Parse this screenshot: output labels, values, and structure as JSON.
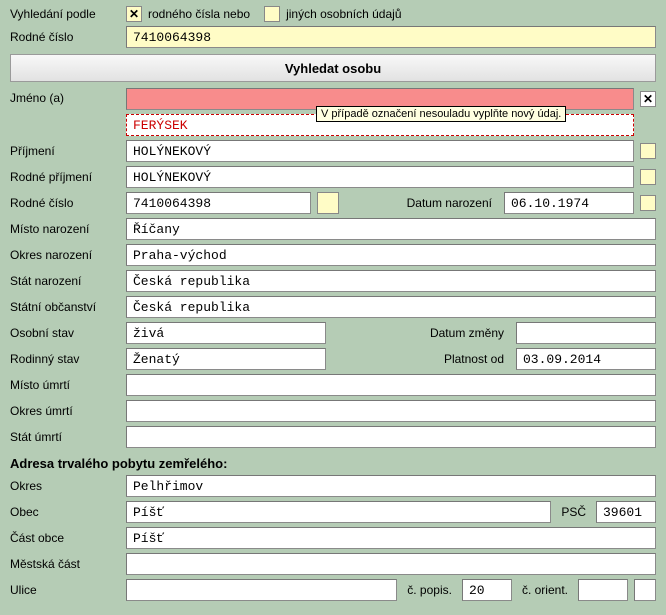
{
  "search": {
    "label": "Vyhledání podle",
    "opt1": "rodného čísla nebo",
    "opt2": "jiných osobních údajů"
  },
  "rc_search": {
    "label": "Rodné číslo",
    "value": "7410064398"
  },
  "search_btn": "Vyhledat osobu",
  "jmeno": {
    "label": "Jméno (a)",
    "value": "",
    "secondary": "FERÝSEK",
    "tooltip": "V případě označení nesouladu vyplňte nový údaj."
  },
  "prijmeni": {
    "label": "Příjmení",
    "value": "HOLÝNEKOVÝ"
  },
  "rodne_prijmeni": {
    "label": "Rodné příjmení",
    "value": "HOLÝNEKOVÝ"
  },
  "rc": {
    "label": "Rodné číslo",
    "value": "7410064398"
  },
  "dob": {
    "label": "Datum narození",
    "value": "06.10.1974"
  },
  "misto_nar": {
    "label": "Místo narození",
    "value": "Říčany"
  },
  "okres_nar": {
    "label": "Okres narození",
    "value": "Praha-východ"
  },
  "stat_nar": {
    "label": "Stát narození",
    "value": "Česká republika"
  },
  "obcanstvi": {
    "label": "Státní občanství",
    "value": "Česká republika"
  },
  "osobni_stav": {
    "label": "Osobní stav",
    "value": "živá"
  },
  "datum_zmeny": {
    "label": "Datum změny",
    "value": ""
  },
  "rodinny": {
    "label": "Rodinný stav",
    "value": "Ženatý"
  },
  "platnost": {
    "label": "Platnost od",
    "value": "03.09.2014"
  },
  "misto_umrti": {
    "label": "Místo úmrtí",
    "value": ""
  },
  "okres_umrti": {
    "label": "Okres úmrtí",
    "value": ""
  },
  "stat_umrti": {
    "label": "Stát úmrtí",
    "value": ""
  },
  "adresa_header": "Adresa trvalého pobytu zemřelého:",
  "okres": {
    "label": "Okres",
    "value": "Pelhřimov"
  },
  "obec": {
    "label": "Obec",
    "value": "Píšť"
  },
  "psc": {
    "label": "PSČ",
    "value": "39601"
  },
  "cast_obce": {
    "label": "Část obce",
    "value": "Píšť"
  },
  "mestska": {
    "label": "Městská část",
    "value": ""
  },
  "ulice": {
    "label": "Ulice",
    "value": ""
  },
  "cpopis": {
    "label": "č. popis.",
    "value": "20"
  },
  "corient": {
    "label": "č. orient.",
    "value": ""
  }
}
